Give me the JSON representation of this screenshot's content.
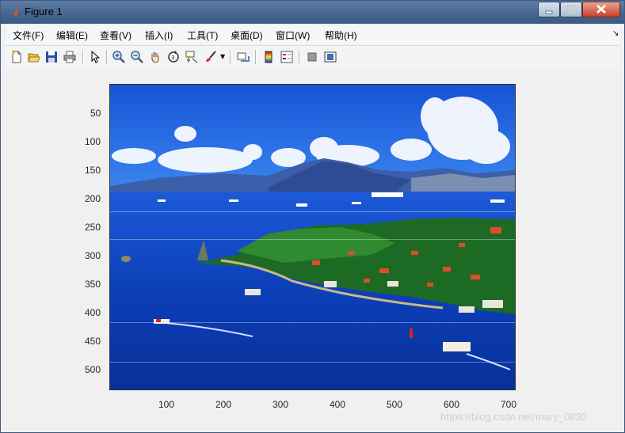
{
  "window": {
    "title": "Figure 1"
  },
  "menu": [
    "文件(F)",
    "编辑(E)",
    "查看(V)",
    "插入(I)",
    "工具(T)",
    "桌面(D)",
    "窗口(W)",
    "帮助(H)"
  ],
  "toolbar": [
    {
      "icon": "new-figure-icon"
    },
    {
      "icon": "open-file-icon"
    },
    {
      "icon": "save-icon"
    },
    {
      "icon": "print-icon"
    },
    {
      "icon": "pointer-icon"
    },
    {
      "icon": "zoom-in-icon"
    },
    {
      "icon": "zoom-out-icon"
    },
    {
      "icon": "pan-icon"
    },
    {
      "icon": "rotate-3d-icon"
    },
    {
      "icon": "data-cursor-icon"
    },
    {
      "icon": "brush-icon"
    },
    {
      "icon": "link-plot-icon"
    },
    {
      "icon": "colorbar-icon"
    },
    {
      "icon": "legend-icon"
    },
    {
      "icon": "hide-plot-tools-icon"
    },
    {
      "icon": "show-plot-tools-icon"
    }
  ],
  "axes": {
    "yticks": [
      "50",
      "100",
      "150",
      "200",
      "250",
      "300",
      "350",
      "400",
      "450",
      "500"
    ],
    "xticks": [
      "100",
      "200",
      "300",
      "400",
      "500",
      "600",
      "700"
    ]
  },
  "image": {
    "description_icon": "island-photo"
  },
  "watermark": "https://blog.csdn.net/mary_0830"
}
